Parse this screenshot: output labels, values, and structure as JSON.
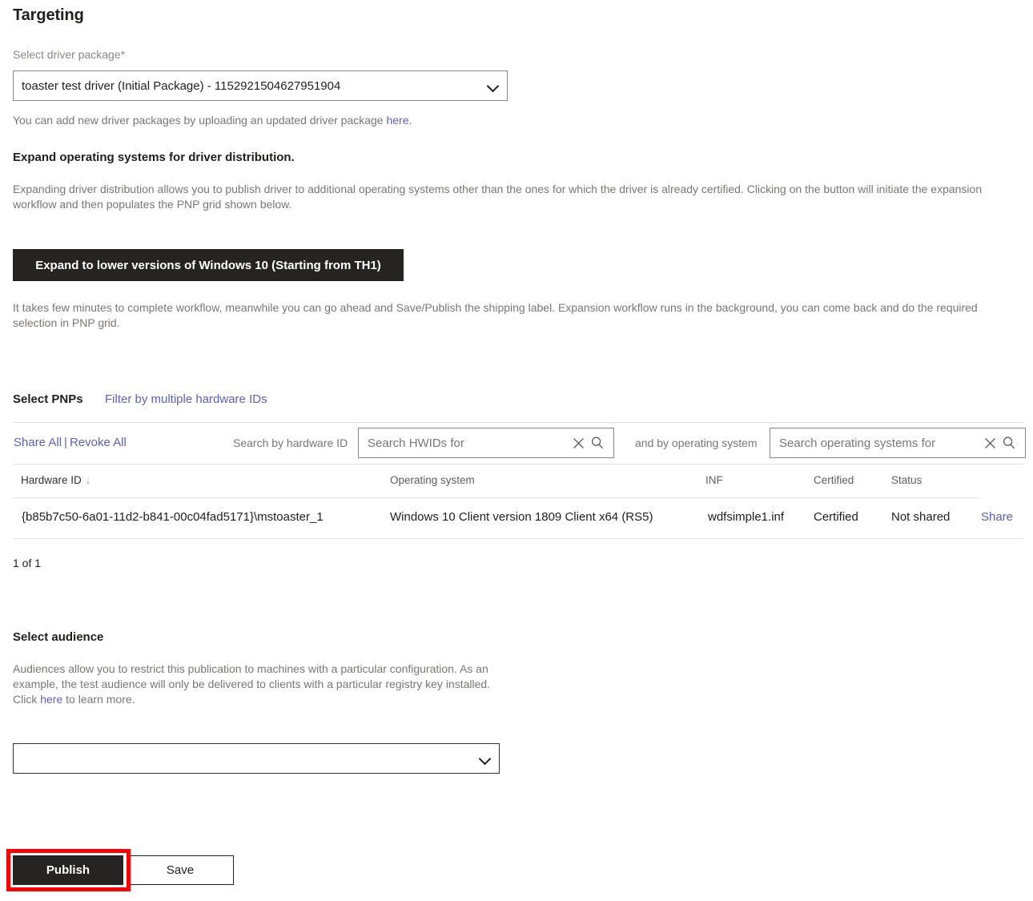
{
  "page": {
    "title": "Targeting"
  },
  "driver_package": {
    "label": "Select driver package*",
    "selected": "toaster test driver (Initial Package) - 1152921504627951904",
    "helper_prefix": "You can add new driver packages by uploading an updated driver package ",
    "helper_link": "here",
    "helper_suffix": "."
  },
  "expand": {
    "heading": "Expand operating systems for driver distribution.",
    "description": "Expanding driver distribution allows you to publish driver to additional operating systems other than the ones for which the driver is already certified. Clicking on the button will initiate the expansion workflow and then populates the PNP grid shown below.",
    "button_label": "Expand to lower versions of Windows 10 (Starting from TH1)",
    "note": "It takes few minutes to complete workflow, meanwhile you can go ahead and Save/Publish the shipping label. Expansion workflow runs in the background, you can come back and do the required selection in PNP grid."
  },
  "pnp": {
    "heading": "Select PNPs",
    "filter_link": "Filter by multiple hardware IDs",
    "share_all": "Share All",
    "separator": "|",
    "revoke_all": "Revoke All",
    "search_hwid_label": "Search by hardware ID",
    "search_hwid_placeholder": "Search HWIDs for",
    "search_os_label": "and by operating system",
    "search_os_placeholder": "Search operating systems for",
    "columns": {
      "hardware_id": "Hardware ID",
      "operating_system": "Operating system",
      "inf": "INF",
      "certified": "Certified",
      "status": "Status"
    },
    "rows": [
      {
        "hardware_id": "{b85b7c50-6a01-11d2-b841-00c04fad5171}\\mstoaster_1",
        "operating_system": "Windows 10 Client version 1809 Client x64 (RS5)",
        "inf": "wdfsimple1.inf",
        "certified": "Certified",
        "status": "Not shared",
        "action": "Share"
      }
    ],
    "paging": "1 of 1"
  },
  "audience": {
    "heading": "Select audience",
    "description_part1": "Audiences allow you to restrict this publication to machines with a particular configuration. As an example, the test audience will only be delivered to clients with a particular registry key installed. Click ",
    "description_link": "here",
    "description_part2": " to learn more.",
    "selected": ""
  },
  "footer": {
    "publish_label": "Publish",
    "save_label": "Save"
  },
  "icons": {
    "chevron_down": "chevron-down-icon",
    "clear": "close-icon",
    "search": "search-icon",
    "sort_desc": "↓"
  },
  "colors": {
    "link": "#5b5fc7",
    "primary_button": "#252423",
    "highlight": "#ff0000",
    "rule": "#e1dfdd"
  }
}
